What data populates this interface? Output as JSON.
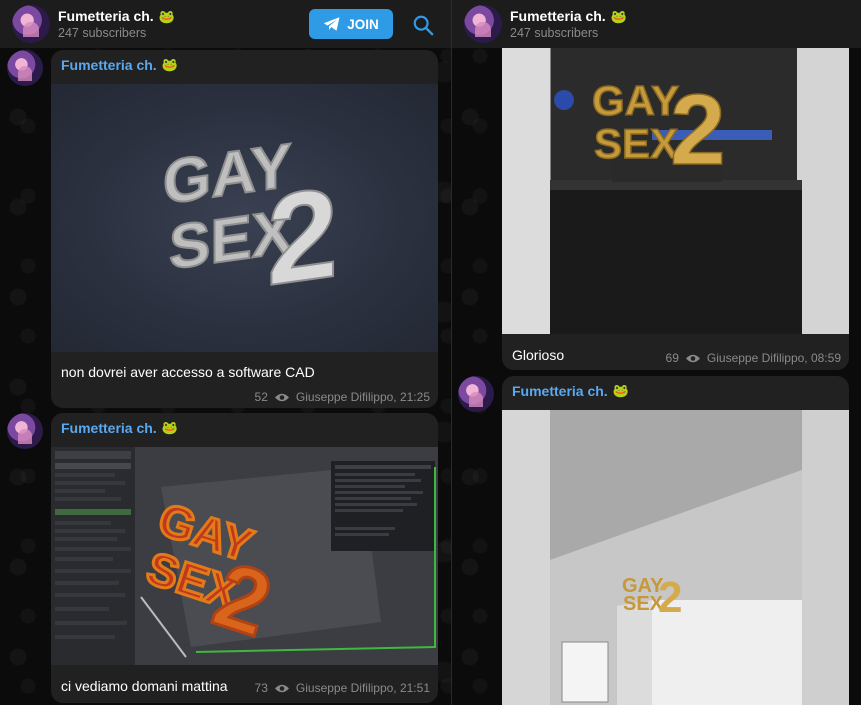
{
  "channel": {
    "title": "Fumetteria ch.",
    "emoji": "🐸",
    "subscribers": "247 subscribers"
  },
  "header": {
    "join_label": "JOIN",
    "search_icon": "search-icon",
    "join_icon": "telegram-plane-icon"
  },
  "left_messages": [
    {
      "sender": "Fumetteria ch.",
      "caption": "non dovrei aver accesso a software CAD",
      "views": "52",
      "author_time": "Giuseppe Difilippo, 21:25"
    },
    {
      "sender": "Fumetteria ch.",
      "caption": "ci vediamo domani mattina",
      "views": "73",
      "author_time": "Giuseppe Difilippo, 21:51"
    }
  ],
  "right_messages": [
    {
      "caption": "Glorioso",
      "views": "69",
      "author_time": "Giuseppe Difilippo, 08:59"
    },
    {
      "sender": "Fumetteria ch."
    }
  ],
  "artwork": {
    "text_top": "GAY",
    "text_bottom": "SEX",
    "numeral": "2"
  },
  "colors": {
    "accent": "#2f9be6",
    "sender": "#5aa9f0",
    "bubble": "#212121",
    "topbar": "#1c1c1d"
  }
}
